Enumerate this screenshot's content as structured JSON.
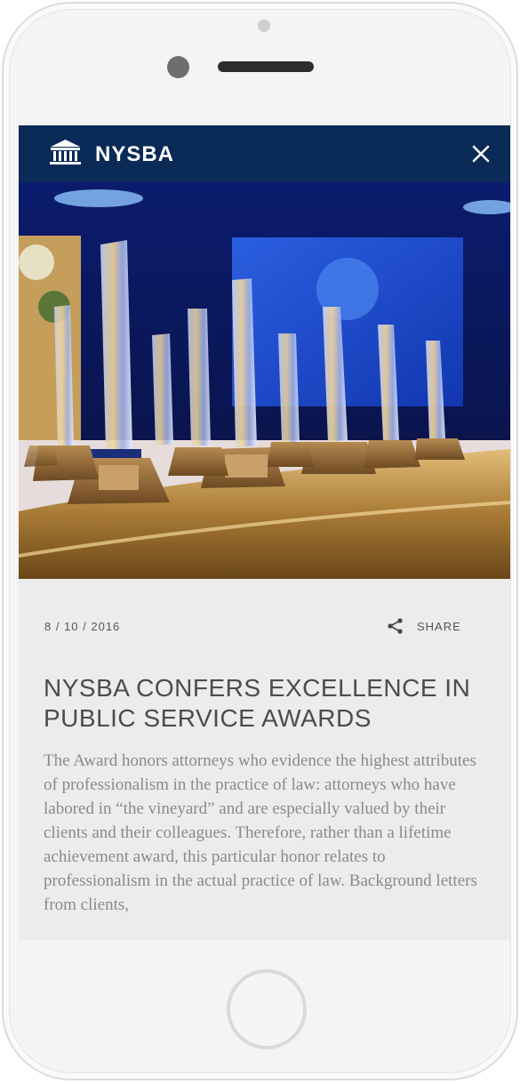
{
  "header": {
    "brand": "NYSBA",
    "logo_icon": "courthouse-icon",
    "close_icon": "close-icon"
  },
  "hero": {
    "alt": "Crystal award trophies on a gold draped table with a blue-lit stage"
  },
  "article": {
    "date": "8 / 10 / 2016",
    "share_label": "SHARE",
    "share_icon": "share-icon",
    "title": "NYSBA CONFERS EXCELLENCE IN PUBLIC SERVICE AWARDS",
    "body": "The Award honors attorneys who evidence the highest attributes of professionalism in the practice of law: attorneys who have labored in “the vineyard” and are especially valued by their clients and their colleagues. Therefore, rather than a lifetime achievement award, this particular honor relates to professionalism in the actual practice of law. Background letters from clients,"
  },
  "colors": {
    "header_bg": "#0a2a57",
    "card_bg": "#ececec",
    "title": "#4c4c4c",
    "body": "#8a8a8a"
  }
}
